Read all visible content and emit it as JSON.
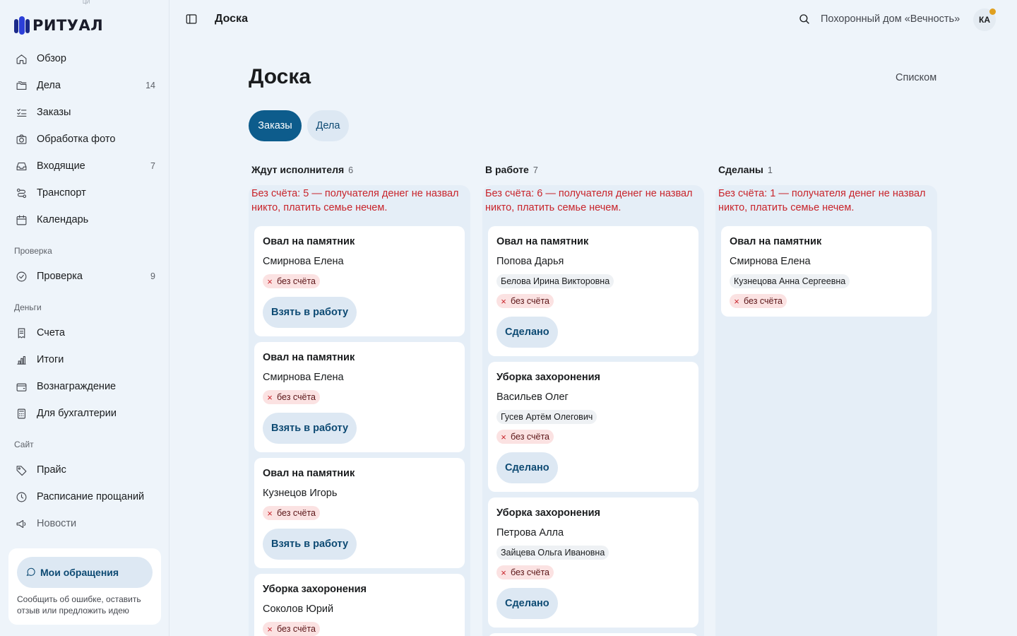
{
  "brand": {
    "name": "РИТУАЛ",
    "sup": "ЦИ"
  },
  "sidebar": {
    "items": [
      {
        "label": "Обзор",
        "count": "",
        "icon": "home-icon"
      },
      {
        "label": "Дела",
        "count": "14",
        "icon": "folders-icon"
      },
      {
        "label": "Заказы",
        "count": "",
        "icon": "checklist-icon"
      },
      {
        "label": "Обработка фото",
        "count": "",
        "icon": "camera-icon"
      },
      {
        "label": "Входящие",
        "count": "7",
        "icon": "inbox-icon"
      },
      {
        "label": "Транспорт",
        "count": "",
        "icon": "route-icon"
      },
      {
        "label": "Календарь",
        "count": "",
        "icon": "calendar-icon"
      }
    ],
    "section_check": "Проверка",
    "check_item": {
      "label": "Проверка",
      "count": "9",
      "icon": "check-circle-icon"
    },
    "section_money": "Деньги",
    "money_items": [
      {
        "label": "Счета",
        "icon": "receipt-icon"
      },
      {
        "label": "Итоги",
        "icon": "bar-chart-icon"
      },
      {
        "label": "Вознаграждение",
        "icon": "wallet-icon"
      },
      {
        "label": "Для бухгалтерии",
        "icon": "calculator-icon"
      }
    ],
    "section_site": "Сайт",
    "site_items": [
      {
        "label": "Прайс",
        "icon": "tag-icon"
      },
      {
        "label": "Расписание прощаний",
        "icon": "clock-icon"
      },
      {
        "label": "Новости",
        "icon": "megaphone-icon"
      }
    ],
    "help_button": "Мои обращения",
    "help_text": "Сообщить об ошибке, оставить отзыв или предложить идею"
  },
  "topbar": {
    "title": "Доска",
    "org": "Похоронный дом «Вечность»",
    "avatar": "КА",
    "notification_color": "#e0a020"
  },
  "main": {
    "title": "Доска",
    "view_link": "Списком",
    "tabs": [
      {
        "label": "Заказы",
        "active": true
      },
      {
        "label": "Дела",
        "active": false
      }
    ]
  },
  "board": {
    "no_bill_chip": "без счёта",
    "columns": [
      {
        "title": "Ждут исполнителя",
        "count": "6",
        "warning": "Без счёта: 5 — получателя денег не назвал никто, платить семье нечем.",
        "cards": [
          {
            "title": "Овал на памятник",
            "name": "Смирнова Елена",
            "executor": "",
            "button": "Взять в работу"
          },
          {
            "title": "Овал на памятник",
            "name": "Смирнова Елена",
            "executor": "",
            "button": "Взять в работу"
          },
          {
            "title": "Овал на памятник",
            "name": "Кузнецов Игорь",
            "executor": "",
            "button": "Взять в работу"
          },
          {
            "title": "Уборка захоронения",
            "name": "Соколов Юрий",
            "executor": "",
            "button": ""
          }
        ]
      },
      {
        "title": "В работе",
        "count": "7",
        "warning": "Без счёта: 6 — получателя денег не назвал никто, платить семье нечем.",
        "cards": [
          {
            "title": "Овал на памятник",
            "name": "Попова Дарья",
            "executor": "Белова Ирина Викторовна",
            "button": "Сделано"
          },
          {
            "title": "Уборка захоронения",
            "name": "Васильев Олег",
            "executor": "Гусев Артём Олегович",
            "button": "Сделано"
          },
          {
            "title": "Уборка захоронения",
            "name": "Петрова Алла",
            "executor": "Зайцева Ольга Ивановна",
            "button": "Сделано"
          }
        ]
      },
      {
        "title": "Сделаны",
        "count": "1",
        "warning": "Без счёта: 1 — получателя денег не назвал никто, платить семье нечем.",
        "cards": [
          {
            "title": "Овал на памятник",
            "name": "Смирнова Елена",
            "executor": "Кузнецова Анна Сергеевна",
            "button": ""
          }
        ]
      }
    ]
  }
}
